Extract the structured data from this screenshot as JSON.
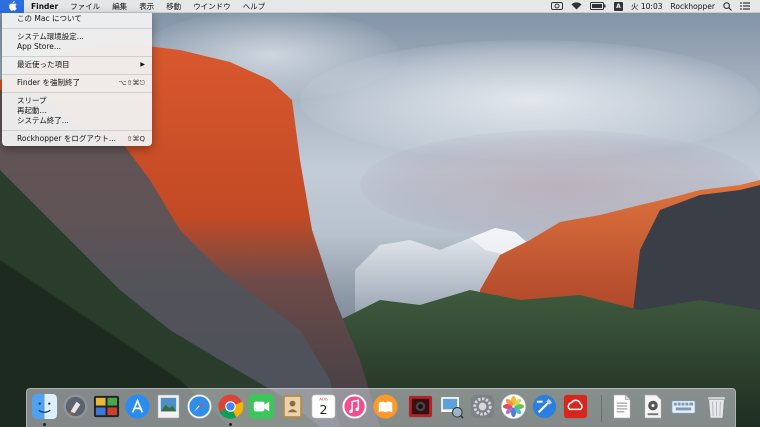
{
  "menubar": {
    "app_name": "Finder",
    "menus": [
      "ファイル",
      "編集",
      "表示",
      "移動",
      "ウインドウ",
      "ヘルプ"
    ],
    "clock": "火 10:03",
    "user": "Rockhopper",
    "input_source": "A",
    "status_icons": [
      "camera-icon",
      "wifi-icon",
      "battery-icon",
      "input-source-icon",
      "spotlight-icon",
      "notification-center-icon"
    ]
  },
  "apple_menu": {
    "items": [
      {
        "label": "この Mac について",
        "shortcut": ""
      },
      {
        "label": "システム環境設定...",
        "shortcut": ""
      },
      {
        "label": "App Store...",
        "shortcut": ""
      },
      {
        "label": "最近使った項目",
        "shortcut": ""
      },
      {
        "label": "Finder を強制終了",
        "shortcut": "⌥⇧⌘⎋"
      },
      {
        "label": "スリープ",
        "shortcut": ""
      },
      {
        "label": "再起動...",
        "shortcut": ""
      },
      {
        "label": "システム終了...",
        "shortcut": ""
      },
      {
        "label": "Rockhopper をログアウト...",
        "shortcut": "⇧⌘Q"
      }
    ],
    "submenu_arrow": "▶"
  },
  "dock": {
    "calendar_month": "AUG",
    "calendar_day": "2",
    "icons": [
      "finder-icon",
      "launchpad-icon",
      "mission-control-icon",
      "app-store-icon",
      "preview-icon",
      "safari-icon",
      "chrome-icon",
      "facetime-icon",
      "contacts-icon",
      "calendar-icon",
      "itunes-icon",
      "ibooks-icon",
      "photo-booth-icon",
      "preview-photos-icon",
      "system-preferences-icon",
      "photos-icon",
      "xcode-icon",
      "creative-cloud-icon",
      "document-icon",
      "printer-icon",
      "keyboard-viewer-icon",
      "trash-icon"
    ]
  },
  "colors": {
    "menu_highlight": "#2e6fe0",
    "menubar_bg": "#ececec",
    "dock_bg": "#d7d7de"
  }
}
